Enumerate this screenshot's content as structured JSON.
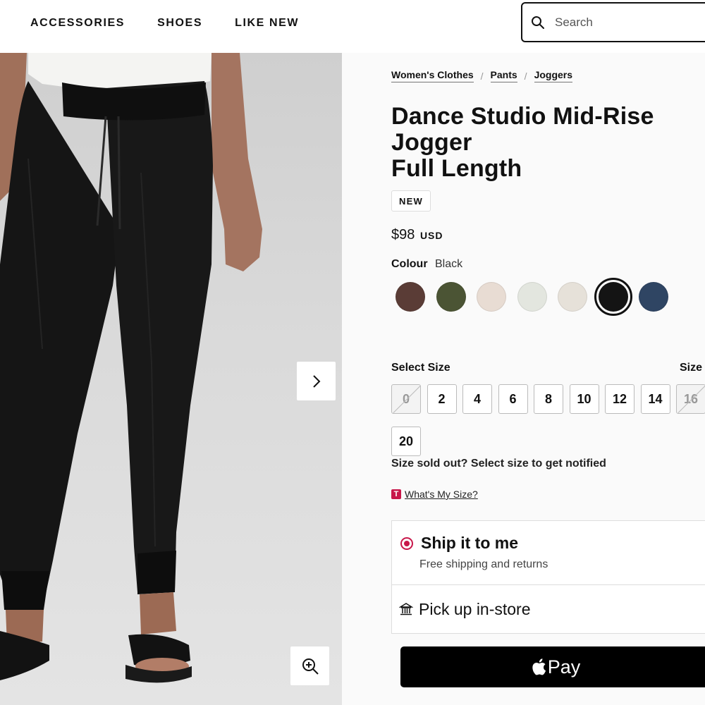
{
  "nav": {
    "links": [
      "ACCESSORIES",
      "SHOES",
      "LIKE NEW"
    ]
  },
  "search": {
    "placeholder": "Search"
  },
  "breadcrumb": [
    "Women's Clothes",
    "Pants",
    "Joggers"
  ],
  "product": {
    "title_lines": [
      "Dance Studio Mid-Rise",
      "Jogger",
      "Full Length"
    ],
    "badge": "NEW",
    "price": "$98",
    "currency": "USD",
    "colour_label": "Colour",
    "colour_value": "Black",
    "swatches": [
      {
        "color": "#5a3c36"
      },
      {
        "color": "#4b5434"
      },
      {
        "color": "#e8dcd3"
      },
      {
        "color": "#e3e6df"
      },
      {
        "color": "#e6e1d9"
      },
      {
        "color": "#141414",
        "selected": true
      },
      {
        "color": "#2f4563"
      }
    ]
  },
  "sizes": {
    "label": "Select Size",
    "guide_label": "Size G",
    "options": [
      {
        "label": "0",
        "sold_out": true
      },
      {
        "label": "2",
        "sold_out": false
      },
      {
        "label": "4",
        "sold_out": false
      },
      {
        "label": "6",
        "sold_out": false
      },
      {
        "label": "8",
        "sold_out": false
      },
      {
        "label": "10",
        "sold_out": false
      },
      {
        "label": "12",
        "sold_out": false
      },
      {
        "label": "14",
        "sold_out": false
      },
      {
        "label": "16",
        "sold_out": true
      },
      {
        "label": "20",
        "sold_out": false
      }
    ],
    "sold_out_note": "Size sold out? Select size to get notified",
    "whats_my_size_badge": "T",
    "whats_my_size": "What's My Size?"
  },
  "fulfilment": {
    "ship_title": "Ship it to me",
    "ship_subtitle": "Free shipping and returns",
    "pickup_title": "Pick up in-store"
  },
  "checkout": {
    "apple_pay_label": "Pay"
  },
  "icons": {
    "search": "search-icon",
    "next": "chevron-right-icon",
    "zoom": "zoom-in-icon",
    "store": "store-icon",
    "apple": "apple-logo-icon"
  },
  "colors": {
    "accent": "#c8174a",
    "text": "#111111"
  }
}
